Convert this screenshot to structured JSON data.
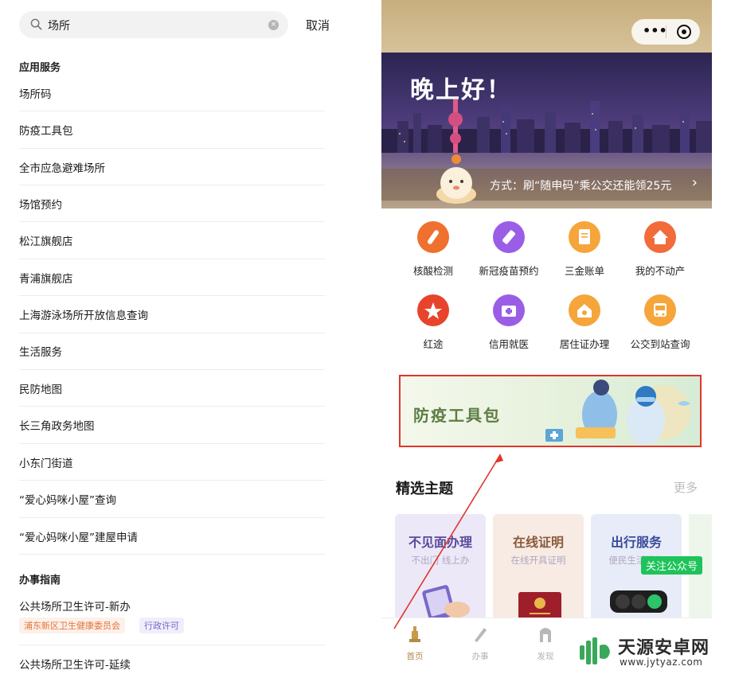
{
  "search": {
    "query": "场所",
    "cancel_label": "取消"
  },
  "services_section": {
    "title": "应用服务",
    "items": [
      "场所码",
      "防疫工具包",
      "全市应急避难场所",
      "场馆预约",
      "松江旗舰店",
      "青浦旗舰店",
      "上海游泳场所开放信息查询",
      "生活服务",
      "民防地图",
      "长三角政务地图",
      "小东门街道",
      "“爱心妈咪小屋”查询",
      "“爱心妈咪小屋”建屋申请"
    ]
  },
  "guide_section": {
    "title": "办事指南",
    "items": [
      {
        "title": "公共场所卫生许可-新办",
        "tags": [
          "浦东新区卫生健康委员会",
          "行政许可"
        ]
      },
      {
        "title": "公共场所卫生许可-延续",
        "tags": []
      }
    ]
  },
  "phone": {
    "greeting": "晚上好！",
    "ticker_text": "方式：刷“随申码”乘公交还能领25元",
    "quick_services": [
      {
        "label": "核酸检测",
        "icon": "test-tube-icon",
        "color": "#f0702f"
      },
      {
        "label": "新冠疫苗预约",
        "icon": "syringe-icon",
        "color": "#9a5ee6"
      },
      {
        "label": "三金账单",
        "icon": "bill-icon",
        "color": "#f6a53a"
      },
      {
        "label": "我的不动产",
        "icon": "house-icon",
        "color": "#f26b3a"
      },
      {
        "label": "红途",
        "icon": "star-icon",
        "color": "#e8442c"
      },
      {
        "label": "信用就医",
        "icon": "medical-kit-icon",
        "color": "#9a5ee6"
      },
      {
        "label": "居住证办理",
        "icon": "home-card-icon",
        "color": "#f6a53a"
      },
      {
        "label": "公交到站查询",
        "icon": "bus-icon",
        "color": "#f6a53a"
      }
    ],
    "promo_text": "防疫工具包",
    "featured_title": "精选主题",
    "more_label": "更多",
    "cards": [
      {
        "title": "不见面办理",
        "subtitle": "不出门 线上办",
        "title_color": "#5a4a9a",
        "bg": "#ece8f8"
      },
      {
        "title": "在线证明",
        "subtitle": "在线开具证明",
        "title_color": "#8a5a3a",
        "bg": "#f7ebe4"
      },
      {
        "title": "出行服务",
        "subtitle": "便民生活服务",
        "title_color": "#3a4a9a",
        "bg": "#e8ecf8"
      }
    ],
    "follow_badge": "关注公众号",
    "tabs": [
      {
        "label": "首页",
        "icon": "home-tab-icon",
        "active": true
      },
      {
        "label": "办事",
        "icon": "pen-tab-icon",
        "active": false
      },
      {
        "label": "发现",
        "icon": "discover-tab-icon",
        "active": false
      }
    ]
  },
  "watermark": {
    "name": "天源安卓网",
    "url": "www.jytyaz.com"
  }
}
